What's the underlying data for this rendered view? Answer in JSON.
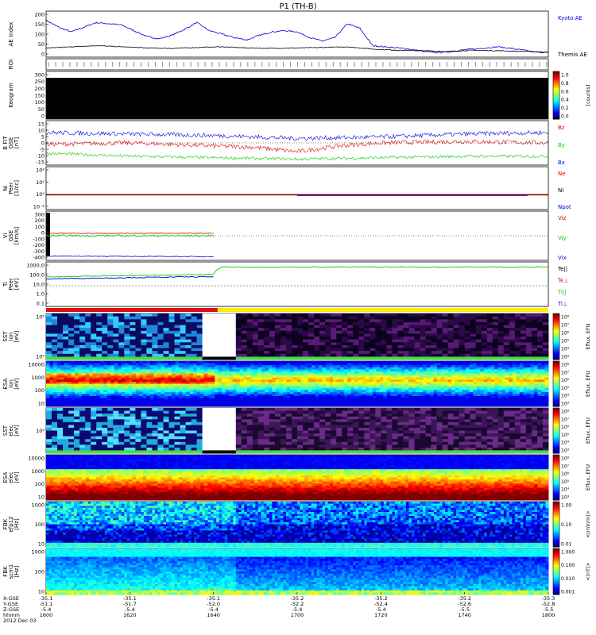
{
  "title": "P1 (TH-B)",
  "chart_data": [
    {
      "type": "line",
      "ylabel": "AE Index",
      "ylim": [
        0,
        200
      ],
      "y_ticks": [
        "200",
        "150",
        "100",
        "50",
        "0"
      ],
      "grid": false,
      "legend": [
        {
          "name": "Kyoto AE",
          "color": "#0000dd"
        },
        {
          "name": "Themis AE",
          "color": "#000000"
        }
      ],
      "series": [
        {
          "name": "Kyoto AE",
          "color": "#0000dd",
          "x": [
            0,
            3,
            6,
            9,
            12,
            15,
            18,
            21,
            24,
            27,
            30,
            33,
            36,
            39,
            42,
            45,
            48,
            51,
            54,
            57,
            60,
            63,
            66,
            69,
            72,
            75,
            78,
            81,
            84,
            87,
            90,
            93,
            96,
            99,
            102,
            105,
            108,
            111,
            114,
            117,
            120
          ],
          "values": [
            160,
            130,
            110,
            130,
            150,
            145,
            140,
            115,
            90,
            80,
            95,
            120,
            150,
            115,
            100,
            85,
            75,
            95,
            110,
            115,
            110,
            85,
            70,
            85,
            145,
            125,
            50,
            45,
            40,
            35,
            25,
            20,
            22,
            30,
            35,
            40,
            45,
            38,
            30,
            22,
            20
          ]
        },
        {
          "name": "Themis AE",
          "color": "#000000",
          "x": [
            0,
            6,
            12,
            18,
            24,
            30,
            36,
            42,
            48,
            54,
            60,
            66,
            72,
            78,
            84,
            90,
            96,
            102,
            108,
            114,
            120
          ],
          "values": [
            40,
            45,
            50,
            45,
            40,
            38,
            42,
            45,
            40,
            38,
            40,
            42,
            45,
            35,
            30,
            28,
            25,
            30,
            28,
            25,
            22
          ]
        }
      ]
    },
    {
      "type": "heatmap",
      "ylabel": "ROI"
    },
    {
      "type": "heatmap",
      "ylabel": "Keogram",
      "y_ticks": [
        "300",
        "250",
        "200",
        "150",
        "100",
        "50",
        "0"
      ],
      "colorbar": {
        "ticks": [
          "1.0",
          "0.8",
          "0.6",
          "0.4",
          "0.2",
          "0.0"
        ],
        "label": "[counts]"
      }
    },
    {
      "type": "line",
      "ylabel": "B FIT\nGSE\n[nT]",
      "ylim": [
        -15,
        15
      ],
      "y_ticks": [
        "15",
        "10",
        "5",
        "0",
        "-5",
        "-10",
        "-15"
      ],
      "legend": [
        {
          "name": "Bz",
          "color": "#dd0000"
        },
        {
          "name": "By",
          "color": "#00cc00"
        },
        {
          "name": "Bx",
          "color": "#0000dd"
        }
      ],
      "series": [
        {
          "name": "Bz",
          "color": "#dd0000",
          "x": [
            0,
            20,
            40,
            50,
            60,
            70,
            80,
            100,
            120
          ],
          "values": [
            -1,
            0,
            -2,
            -3,
            -6,
            -2,
            0,
            1,
            0
          ]
        },
        {
          "name": "By",
          "color": "#00cc00",
          "x": [
            0,
            20,
            40,
            60,
            80,
            100,
            120
          ],
          "values": [
            -7,
            -9,
            -10,
            -11,
            -10,
            -9,
            -9
          ]
        },
        {
          "name": "Bx",
          "color": "#0000dd",
          "x": [
            0,
            20,
            40,
            60,
            80,
            100,
            120
          ],
          "values": [
            7,
            6,
            5,
            3,
            4,
            6,
            7
          ]
        }
      ]
    },
    {
      "type": "line",
      "ylabel": "Ni\nPeer\n[1/cc]",
      "y_ticks": [
        "10⁴",
        "10²",
        "10⁰",
        "10⁻²"
      ],
      "legend": [
        {
          "name": "Ne",
          "color": "#dd0000"
        },
        {
          "name": "Ni",
          "color": "#000000"
        },
        {
          "name": "Npot",
          "color": "#0000dd"
        }
      ]
    },
    {
      "type": "line",
      "ylabel": "Vi\nGSE\n[km/s]",
      "ylim": [
        -400,
        400
      ],
      "y_ticks": [
        "300",
        "200",
        "100",
        "0",
        "-100",
        "-200",
        "-300",
        "-400"
      ],
      "legend": [
        {
          "name": "Viz",
          "color": "#dd0000"
        },
        {
          "name": "Viy",
          "color": "#00cc00"
        },
        {
          "name": "Vix",
          "color": "#0000dd"
        }
      ],
      "series": [
        {
          "name": "Viz",
          "color": "#dd0000",
          "x": [
            0,
            40
          ],
          "values": [
            40,
            40
          ]
        },
        {
          "name": "Viy",
          "color": "#00cc00",
          "x": [
            0,
            40
          ],
          "values": [
            0,
            0
          ]
        },
        {
          "name": "Vix",
          "color": "#0000dd",
          "x": [
            0,
            40
          ],
          "values": [
            -330,
            -340
          ]
        }
      ]
    },
    {
      "type": "line",
      "ylabel": "Ti\nPeer\n[eV]",
      "y_ticks": [
        "1000.0",
        "100.0",
        "10.0",
        "1.0",
        "0.1"
      ],
      "legend": [
        {
          "name": "Te||",
          "color": "#000000"
        },
        {
          "name": "Te⊥",
          "color": "#dd0000"
        },
        {
          "name": "Ti||",
          "color": "#00cc00"
        },
        {
          "name": "Ti⊥",
          "color": "#0000dd"
        }
      ],
      "series": [
        {
          "name": "Ti||",
          "color": "#00cc00",
          "x": [
            0,
            40,
            42,
            120
          ],
          "values": [
            55,
            100,
            600,
            600
          ]
        },
        {
          "name": "Ti⊥",
          "color": "#0000dd",
          "x": [
            0,
            40
          ],
          "values": [
            35,
            60
          ]
        }
      ]
    },
    {
      "type": "heatmap",
      "ylabel": "SST\nion\n[eV]",
      "y_ticks": [
        "10⁶",
        "10⁵"
      ],
      "colorbar": {
        "ticks": [
          "10⁸",
          "10⁷",
          "10⁶",
          "10⁵",
          "10⁴",
          "10³"
        ],
        "label": "Eflux, EFU"
      }
    },
    {
      "type": "heatmap",
      "ylabel": "ESA\nion\n[eV]",
      "y_ticks": [
        "10000",
        "1000",
        "100",
        "10"
      ],
      "colorbar": {
        "ticks": [
          "10⁸",
          "10⁷",
          "10⁶",
          "10⁵",
          "10⁴",
          "10³"
        ],
        "label": "Eflux, EFU"
      }
    },
    {
      "type": "heatmap",
      "ylabel": "SST\nelec\n[eV]",
      "y_ticks": [
        "10⁵"
      ],
      "colorbar": {
        "ticks": [
          "10⁸",
          "10⁷",
          "10⁶",
          "10⁵",
          "10⁴",
          "10³"
        ],
        "label": "Eflux, EFU"
      }
    },
    {
      "type": "heatmap",
      "ylabel": "ESA\nelec\n[eV]",
      "y_ticks": [
        "10000",
        "1000",
        "100",
        "10"
      ],
      "colorbar": {
        "ticks": [
          "10⁸",
          "10⁷",
          "10⁶",
          "10⁵",
          "10⁴",
          "10³"
        ],
        "label": "Eflux, EFU"
      }
    },
    {
      "type": "heatmap",
      "ylabel": "FBK\nefp12\n[Hz]",
      "y_ticks": [
        "1000",
        "100",
        "10"
      ],
      "colorbar": {
        "ticks": [
          "1.00",
          "0.10",
          "0.01"
        ],
        "label": "<|mV/m|>"
      }
    },
    {
      "type": "heatmap",
      "ylabel": "FBK\nscm1\n[Hz]",
      "y_ticks": [
        "1000",
        "100",
        "10"
      ],
      "colorbar": {
        "ticks": [
          "1.000",
          "0.100",
          "0.010",
          "0.001"
        ],
        "label": "<|nT|>"
      }
    }
  ],
  "x_axis": {
    "row_labels": [
      "X-GSE",
      "Y-GSE",
      "Z-GSE",
      "hhmm",
      "2012 Dec 03"
    ],
    "columns": [
      [
        "-35.1",
        "-51.1",
        "-5.4",
        "1600"
      ],
      [
        "-35.1",
        "-51.7",
        "-5.4",
        "1620"
      ],
      [
        "-35.1",
        "-52.0",
        "-5.4",
        "1640"
      ],
      [
        "-35.2",
        "-52.2",
        "-5.4",
        "1700"
      ],
      [
        "-35.2",
        "-52.4",
        "-5.4",
        "1720"
      ],
      [
        "-35.2",
        "-52.6",
        "-5.5",
        "1740"
      ],
      [
        "-35.3",
        "-52.8",
        "-5.5",
        "1800"
      ]
    ]
  }
}
